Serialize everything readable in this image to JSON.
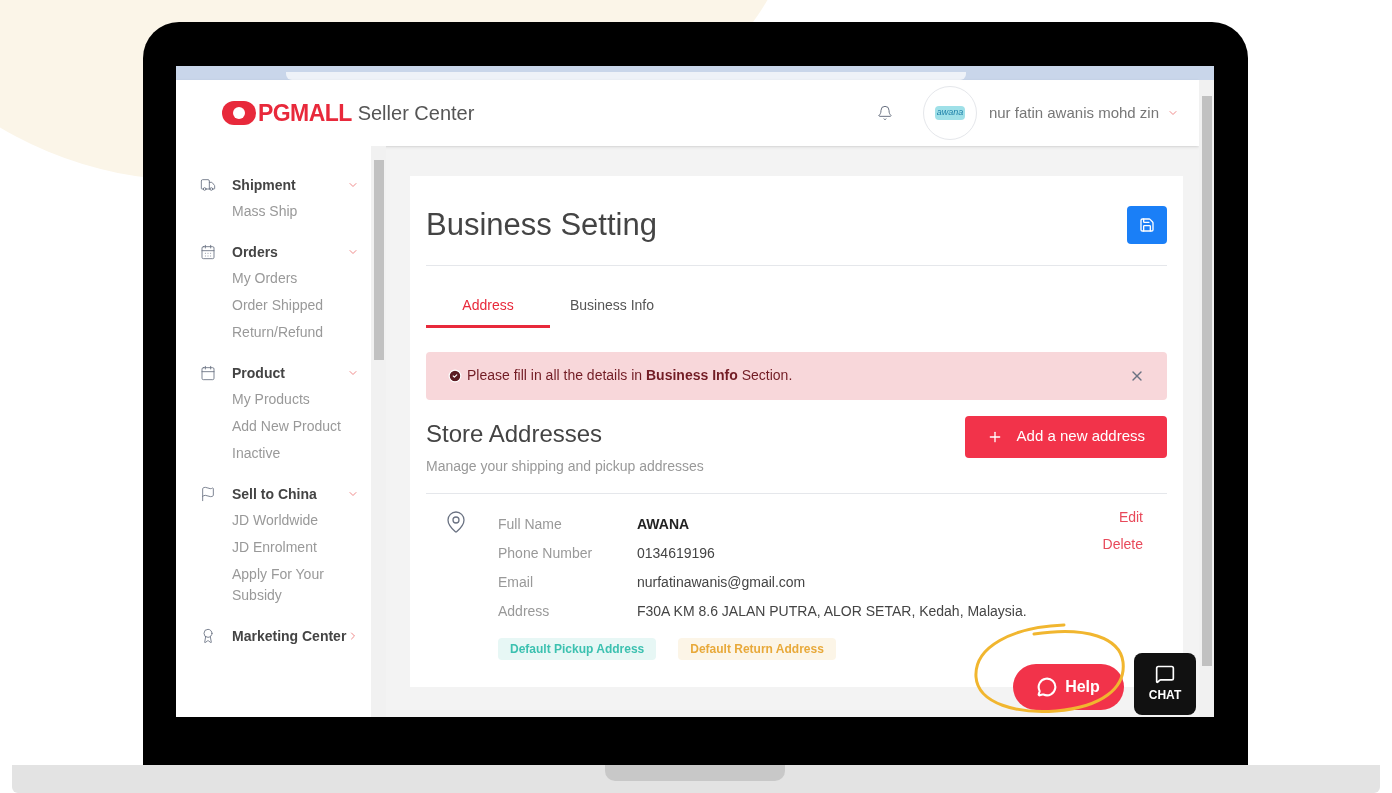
{
  "header": {
    "logo": "PGMALL",
    "subtitle": "Seller Center",
    "avatar_text": "awana",
    "user_name": "nur fatin awanis mohd zin"
  },
  "sidebar": {
    "sections": [
      {
        "label": "Shipment",
        "expanded": true,
        "children": [
          {
            "label": "Mass Ship"
          }
        ]
      },
      {
        "label": "Orders",
        "expanded": true,
        "children": [
          {
            "label": "My Orders"
          },
          {
            "label": "Order Shipped"
          },
          {
            "label": "Return/Refund"
          }
        ]
      },
      {
        "label": "Product",
        "expanded": true,
        "children": [
          {
            "label": "My Products"
          },
          {
            "label": "Add New Product"
          },
          {
            "label": "Inactive"
          }
        ]
      },
      {
        "label": "Sell to China",
        "expanded": true,
        "children": [
          {
            "label": "JD Worldwide"
          },
          {
            "label": "JD Enrolment"
          },
          {
            "label": "Apply For Your Subsidy"
          }
        ]
      },
      {
        "label": "Marketing Center",
        "expanded": false
      }
    ]
  },
  "page": {
    "title": "Business Setting",
    "tabs": [
      {
        "label": "Address",
        "selected": true
      },
      {
        "label": "Business Info",
        "selected": false
      }
    ],
    "alert": "Please fill in all the details in **Business Info** Section.",
    "section_title": "Store Addresses",
    "section_subtitle": "Manage your shipping and pickup addresses",
    "add_button": "Add a new address",
    "address": {
      "fields": [
        {
          "label": "Full Name",
          "value": "AWANA",
          "kind": "bold"
        },
        {
          "label": "Phone Number",
          "value": "0134619196",
          "kind": "plain"
        },
        {
          "label": "Email",
          "value": "nurfatinawanis@gmail.com",
          "kind": "plain"
        },
        {
          "label": "Address",
          "value": "F30A KM 8.6 JALAN PUTRA, ALOR SETAR, Kedah, Malaysia.",
          "kind": "plain"
        }
      ],
      "actions": [
        "Edit",
        "Delete"
      ],
      "tags": [
        {
          "label": "Default Pickup Address",
          "color": "#3cc1b0"
        },
        {
          "label": "Default Return Address",
          "color": "#e8a93a"
        }
      ]
    }
  },
  "help_button": "Help",
  "chat_button": "CHAT"
}
